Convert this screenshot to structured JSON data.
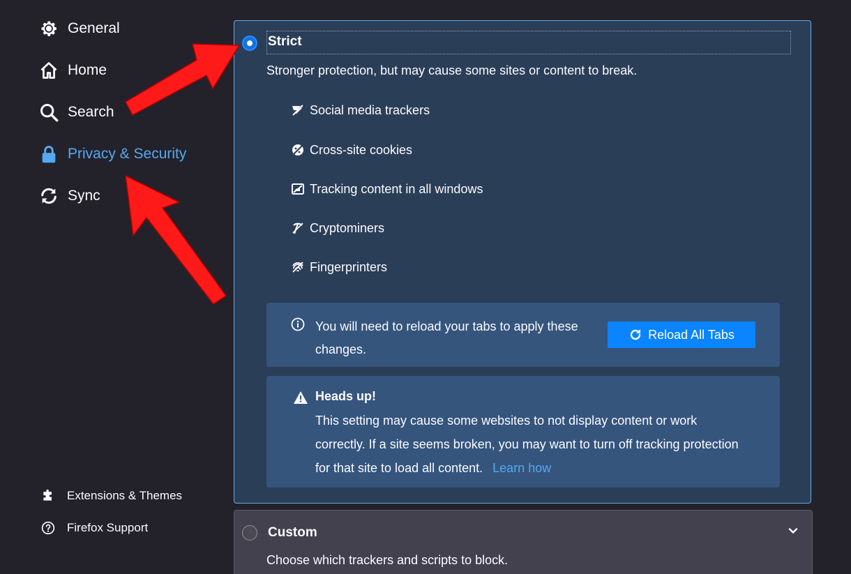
{
  "sidebar": {
    "items": [
      {
        "label": "General",
        "icon": "gear-icon"
      },
      {
        "label": "Home",
        "icon": "home-icon"
      },
      {
        "label": "Search",
        "icon": "search-icon"
      },
      {
        "label": "Privacy & Security",
        "icon": "lock-icon",
        "active": true
      },
      {
        "label": "Sync",
        "icon": "sync-icon"
      }
    ],
    "footer": [
      {
        "label": "Extensions & Themes",
        "icon": "puzzle-icon"
      },
      {
        "label": "Firefox Support",
        "icon": "help-icon"
      }
    ]
  },
  "strict": {
    "title": "Strict",
    "selected": true,
    "description": "Stronger protection, but may cause some sites or content to break.",
    "trackers": [
      {
        "label": "Social media trackers",
        "icon": "social-tracker-icon"
      },
      {
        "label": "Cross-site cookies",
        "icon": "cookie-icon"
      },
      {
        "label": "Tracking content in all windows",
        "icon": "tracking-content-icon"
      },
      {
        "label": "Cryptominers",
        "icon": "cryptominer-icon"
      },
      {
        "label": "Fingerprinters",
        "icon": "fingerprinter-icon"
      }
    ],
    "reload": {
      "message": "You will need to reload your tabs to apply these changes.",
      "button_label": "Reload All Tabs"
    },
    "heads_up": {
      "title": "Heads up!",
      "message": "This setting may cause some websites to not display content or work correctly. If a site seems broken, you may want to turn off tracking protection for that site to load all content.",
      "link_label": "Learn how"
    }
  },
  "custom": {
    "title": "Custom",
    "selected": false,
    "description": "Choose which trackers and scripts to block."
  },
  "colors": {
    "background": "#23222b",
    "accent": "#54a9f0",
    "card": "#2b3e57",
    "button": "#0a84ff",
    "annotation_arrow": "#ff1a1a"
  }
}
